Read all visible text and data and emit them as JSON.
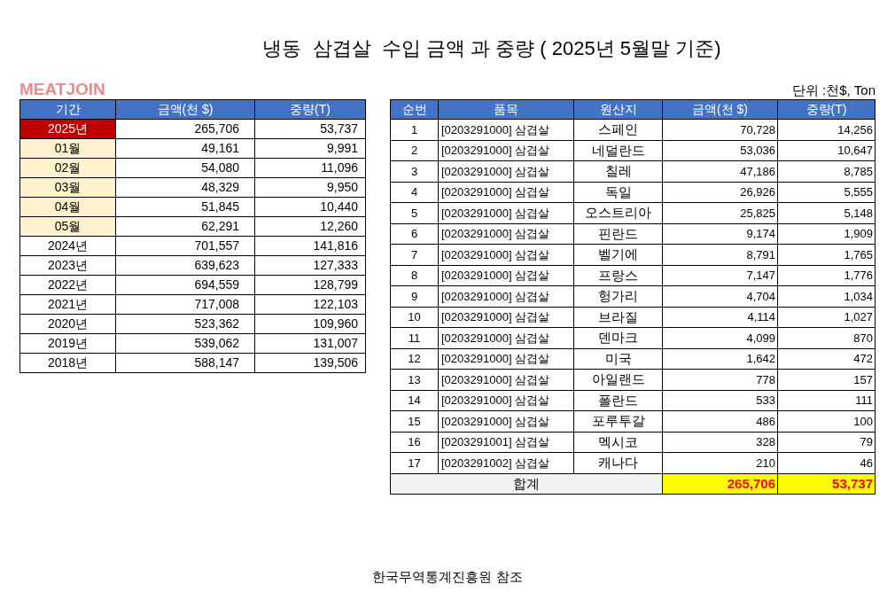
{
  "title": "냉동  삼겹살  수입 금액 과 중량 ( 2025년 5월말 기준)",
  "logo": "MEATJOIN",
  "unit_note": "단위 :천$, Ton",
  "period_table": {
    "columns": [
      "기간",
      "금액(천 $)",
      "중량(T)"
    ],
    "rows": [
      {
        "kind": "current",
        "period": "2025년",
        "amount": "265,706",
        "weight": "53,737"
      },
      {
        "kind": "month",
        "period": "01월",
        "amount": "49,161",
        "weight": "9,991"
      },
      {
        "kind": "month",
        "period": "02월",
        "amount": "54,080",
        "weight": "11,096"
      },
      {
        "kind": "month",
        "period": "03월",
        "amount": "48,329",
        "weight": "9,950"
      },
      {
        "kind": "month",
        "period": "04월",
        "amount": "51,845",
        "weight": "10,440"
      },
      {
        "kind": "month",
        "period": "05월",
        "amount": "62,291",
        "weight": "12,260"
      },
      {
        "kind": "year",
        "period": "2024년",
        "amount": "701,557",
        "weight": "141,816"
      },
      {
        "kind": "year",
        "period": "2023년",
        "amount": "639,623",
        "weight": "127,333"
      },
      {
        "kind": "year",
        "period": "2022년",
        "amount": "694,559",
        "weight": "128,799"
      },
      {
        "kind": "year",
        "period": "2021년",
        "amount": "717,008",
        "weight": "122,103"
      },
      {
        "kind": "year",
        "period": "2020년",
        "amount": "523,362",
        "weight": "109,960"
      },
      {
        "kind": "year",
        "period": "2019년",
        "amount": "539,062",
        "weight": "131,007"
      },
      {
        "kind": "year",
        "period": "2018년",
        "amount": "588,147",
        "weight": "139,506"
      }
    ]
  },
  "origin_table": {
    "columns": [
      "순번",
      "품목",
      "원산지",
      "금액(천 $)",
      "중량(T)"
    ],
    "rows": [
      {
        "no": "1",
        "item": "[0203291000] 삼겹살",
        "origin": "스페인",
        "amount": "70,728",
        "weight": "14,256"
      },
      {
        "no": "2",
        "item": "[0203291000] 삼겹살",
        "origin": "네덜란드",
        "amount": "53,036",
        "weight": "10,647"
      },
      {
        "no": "3",
        "item": "[0203291000] 삼겹살",
        "origin": "칠레",
        "amount": "47,186",
        "weight": "8,785"
      },
      {
        "no": "4",
        "item": "[0203291000] 삼겹살",
        "origin": "독일",
        "amount": "26,926",
        "weight": "5,555"
      },
      {
        "no": "5",
        "item": "[0203291000] 삼겹살",
        "origin": "오스트리아",
        "amount": "25,825",
        "weight": "5,148"
      },
      {
        "no": "6",
        "item": "[0203291000] 삼겹살",
        "origin": "핀란드",
        "amount": "9,174",
        "weight": "1,909"
      },
      {
        "no": "7",
        "item": "[0203291000] 삼겹살",
        "origin": "벨기에",
        "amount": "8,791",
        "weight": "1,765"
      },
      {
        "no": "8",
        "item": "[0203291000] 삼겹살",
        "origin": "프랑스",
        "amount": "7,147",
        "weight": "1,776"
      },
      {
        "no": "9",
        "item": "[0203291000] 삼겹살",
        "origin": "헝가리",
        "amount": "4,704",
        "weight": "1,034"
      },
      {
        "no": "10",
        "item": "[0203291000] 삼겹살",
        "origin": "브라질",
        "amount": "4,114",
        "weight": "1,027"
      },
      {
        "no": "11",
        "item": "[0203291000] 삼겹살",
        "origin": "덴마크",
        "amount": "4,099",
        "weight": "870"
      },
      {
        "no": "12",
        "item": "[0203291000] 삼겹살",
        "origin": "미국",
        "amount": "1,642",
        "weight": "472"
      },
      {
        "no": "13",
        "item": "[0203291000] 삼겹살",
        "origin": "아일랜드",
        "amount": "778",
        "weight": "157"
      },
      {
        "no": "14",
        "item": "[0203291000] 삼겹살",
        "origin": "폴란드",
        "amount": "533",
        "weight": "111"
      },
      {
        "no": "15",
        "item": "[0203291000] 삼겹살",
        "origin": "포루투갈",
        "amount": "486",
        "weight": "100"
      },
      {
        "no": "16",
        "item": "[0203291001] 삼겹살",
        "origin": "멕시코",
        "amount": "328",
        "weight": "79"
      },
      {
        "no": "17",
        "item": "[0203291002] 삼겹살",
        "origin": "캐나다",
        "amount": "210",
        "weight": "46"
      }
    ],
    "total": {
      "label": "합계",
      "amount": "265,706",
      "weight": "53,737"
    }
  },
  "footer": "한국무역통계진흥원 참조"
}
